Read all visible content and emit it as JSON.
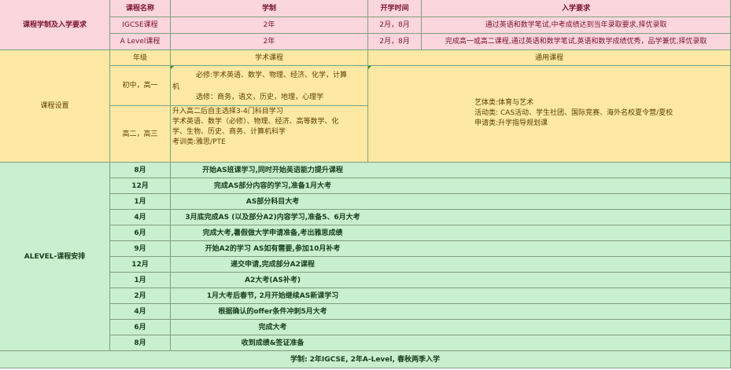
{
  "admission": {
    "group_label": "课程学制及入学要求",
    "headers": {
      "course": "课程名称",
      "duration": "学制",
      "start": "开学时间",
      "req": "入学要求"
    },
    "rows": [
      {
        "course": "IGCSE课程",
        "duration": "2年",
        "start": "2月，8月",
        "req": "通过英语和数学笔试,中考成绩达到当年录取要求,择优录取"
      },
      {
        "course": "A Level课程",
        "duration": "2年",
        "start": "2月，8月",
        "req": "完成高一或高二课程,通过英语和数学笔试,英语和数学成绩优秀，品学兼优,择优录取"
      }
    ]
  },
  "courses": {
    "group_label": "课程设置",
    "headers": {
      "grade": "年级",
      "academic": "学术课程",
      "general": "通用课程"
    },
    "row1": {
      "grade": "初中，高一",
      "prefix": "机",
      "required": "必修:学术英语、数学、物理、经济、化学，计算",
      "elective": "选修：商务，语文，历史，地理，心理学"
    },
    "row2": {
      "grade": "高二，高三",
      "lines": [
        "升入高二后自主选择3-4门科目学习",
        "学术英语、数学（必修）、物理、经济、高等数学、化",
        "学、生物、历史、商务、计算机科学",
        "考训类:雅思/PTE"
      ]
    },
    "general_lines": [
      "艺体类:体育与艺术",
      "活动类: CAS活动、学生社团、国际竞赛、海外名校夏令营/夏校",
      "申请类:升学指导规划课"
    ]
  },
  "schedule": {
    "group_label": "ALEVEL-课程安排",
    "rows": [
      {
        "month": "8月",
        "text": "开始AS班课学习,同时开始英语能力提升课程"
      },
      {
        "month": "12月",
        "text": "完成AS部分内容的学习,准备1月大考"
      },
      {
        "month": "1月",
        "text": "AS部分科目大考"
      },
      {
        "month": "4月",
        "text": "3月底完成AS (以及部分A2)内容学习,准备5、6月大考"
      },
      {
        "month": "6月",
        "text": "完成大考,暑假做大学申请准备,考出雅思成绩"
      },
      {
        "month": "9月",
        "text": "开始A2的学习  AS如有需要,参加10月补考"
      },
      {
        "month": "12月",
        "text": "递交申请,完成部分A2课程"
      },
      {
        "month": "1月",
        "text": "A2大考(AS补考)"
      },
      {
        "month": "2月",
        "text": "1月大考后春节, 2月开始继续AS新课学习"
      },
      {
        "month": "4月",
        "text": "根据确认的offer条件冲刺5月大考"
      },
      {
        "month": "6月",
        "text": "完成大考"
      },
      {
        "month": "8月",
        "text": "收到成绩&签证准备"
      }
    ]
  },
  "footer": "学制: 2年IGCSE, 2年A-Level, 春秋两季入学",
  "colors": {
    "pink": "#fbd6dc",
    "yellow": "#fde9a4",
    "green": "#c8efcf",
    "border": "#7f9f7f"
  }
}
